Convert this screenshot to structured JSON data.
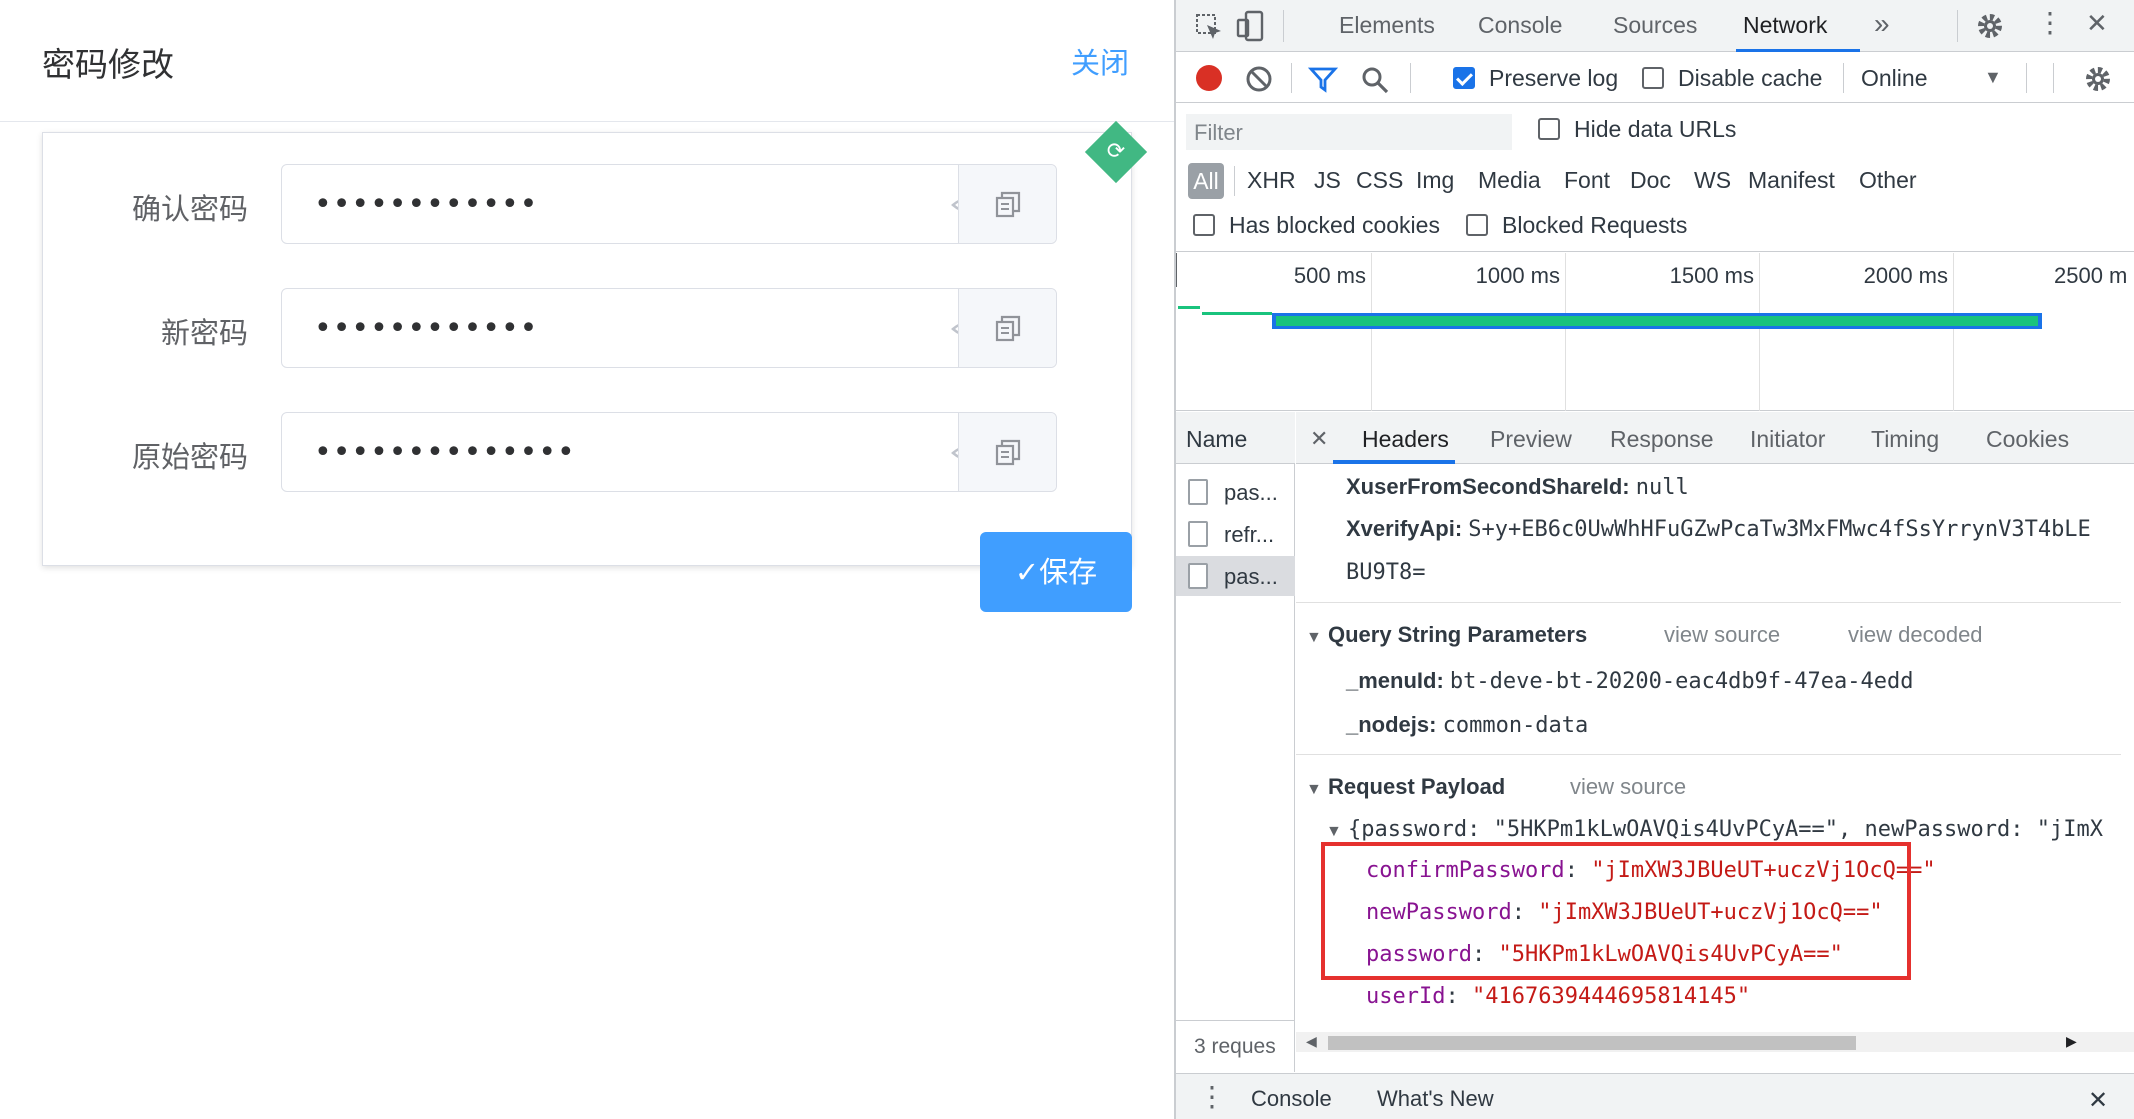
{
  "dialog": {
    "title": "密码修改",
    "close_label": "关闭",
    "fields": [
      {
        "label": "确认密码",
        "value": "••••••••••••"
      },
      {
        "label": "新密码",
        "value": "••••••••••••"
      },
      {
        "label": "原始密码",
        "value": "••••••••••••••"
      }
    ],
    "save_label": "✓保存"
  },
  "devtools": {
    "tabs": [
      "Elements",
      "Console",
      "Sources",
      "Network"
    ],
    "active_tab": "Network",
    "more_tabs": "»",
    "toolbar": {
      "preserve_log": "Preserve log",
      "preserve_log_checked": true,
      "disable_cache": "Disable cache",
      "disable_cache_checked": false,
      "throttling": "Online"
    },
    "filter": {
      "placeholder": "Filter",
      "hide_data_urls": "Hide data URLs",
      "types": [
        "All",
        "XHR",
        "JS",
        "CSS",
        "Img",
        "Media",
        "Font",
        "Doc",
        "WS",
        "Manifest",
        "Other"
      ],
      "has_blocked_cookies": "Has blocked cookies",
      "blocked_requests": "Blocked Requests"
    },
    "timeline_ticks": [
      "500 ms",
      "1000 ms",
      "1500 ms",
      "2000 ms",
      "2500 m"
    ],
    "name_column": {
      "header": "Name",
      "rows": [
        "pas...",
        "refr...",
        "pas..."
      ],
      "footer": "3 reques"
    },
    "detail_tabs": [
      "Headers",
      "Preview",
      "Response",
      "Initiator",
      "Timing",
      "Cookies"
    ],
    "headers": {
      "xuser_key": "XuserFromSecondShareId:",
      "xuser_val": "null",
      "xverify_key": "XverifyApi:",
      "xverify_val": "S+y+EB6c0UwWhHFuGZwPcaTw3MxFMwc4fSsYrrynV3T4bLE",
      "xverify_val2": "BU9T8="
    },
    "query": {
      "title": "Query String Parameters",
      "view_source": "view source",
      "view_decoded": "view decoded",
      "menuid_key": "_menuId:",
      "menuid_val": "bt-deve-bt-20200-eac4db9f-47ea-4edd",
      "nodejs_key": "_nodejs:",
      "nodejs_val": "common-data"
    },
    "payload": {
      "title": "Request Payload",
      "view_source": "view source",
      "summary": "{password: \"5HKPm1kLwOAVQis4UvPCyA==\", newPassword: \"jImX",
      "items": [
        {
          "key": "confirmPassword",
          "value": "\"jImXW3JBUeUT+uczVj1OcQ==\""
        },
        {
          "key": "newPassword",
          "value": "\"jImXW3JBUeUT+uczVj1OcQ==\""
        },
        {
          "key": "password",
          "value": "\"5HKPm1kLwOAVQis4UvPCyA==\""
        },
        {
          "key": "userId",
          "value": "\"4167639444695814145\""
        }
      ]
    },
    "drawer_tabs": [
      "Console",
      "What's New"
    ]
  }
}
